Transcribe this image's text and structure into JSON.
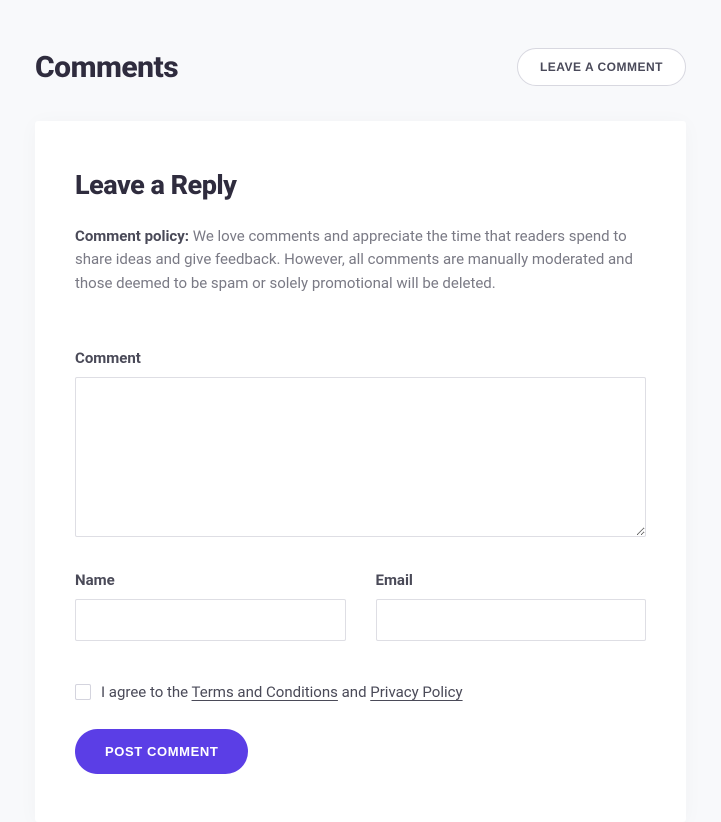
{
  "header": {
    "title": "Comments",
    "leave_comment_button": "LEAVE A COMMENT"
  },
  "form": {
    "title": "Leave a Reply",
    "policy_label": "Comment policy:",
    "policy_text": " We love comments and appreciate the time that readers spend to share ideas and give feedback. However, all comments are manually moderated and those deemed to be spam or solely promotional will be deleted.",
    "comment_label": "Comment",
    "comment_value": "",
    "name_label": "Name",
    "name_value": "",
    "email_label": "Email",
    "email_value": "",
    "agree_prefix": "I agree to the ",
    "terms_link": "Terms and Conditions",
    "agree_mid": " and ",
    "privacy_link": "Privacy Policy",
    "submit_label": "POST COMMENT"
  }
}
